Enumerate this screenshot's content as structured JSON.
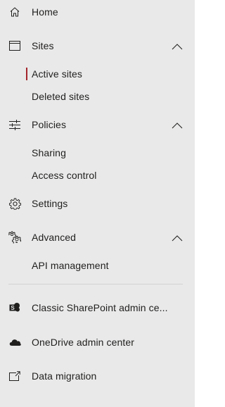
{
  "nav": {
    "home": {
      "label": "Home",
      "icon": "home-icon"
    },
    "sites": {
      "label": "Sites",
      "icon": "browser-window-icon",
      "expanded": true,
      "children": [
        {
          "label": "Active sites",
          "selected": true
        },
        {
          "label": "Deleted sites",
          "selected": false
        }
      ]
    },
    "policies": {
      "label": "Policies",
      "icon": "sliders-icon",
      "expanded": true,
      "children": [
        {
          "label": "Sharing"
        },
        {
          "label": "Access control"
        }
      ]
    },
    "settings": {
      "label": "Settings",
      "icon": "gear-icon"
    },
    "advanced": {
      "label": "Advanced",
      "icon": "gears-icon",
      "expanded": true,
      "children": [
        {
          "label": "API management"
        }
      ]
    },
    "links": [
      {
        "label": "Classic SharePoint admin ce...",
        "icon": "sharepoint-logo-icon"
      },
      {
        "label": "OneDrive admin center",
        "icon": "onedrive-cloud-icon"
      },
      {
        "label": "Data migration",
        "icon": "external-link-icon"
      }
    ]
  },
  "colors": {
    "nav_background": "#e9e9e9",
    "text": "#201f1e",
    "selected_accent": "#a4262c",
    "divider": "#d2d2d2"
  }
}
